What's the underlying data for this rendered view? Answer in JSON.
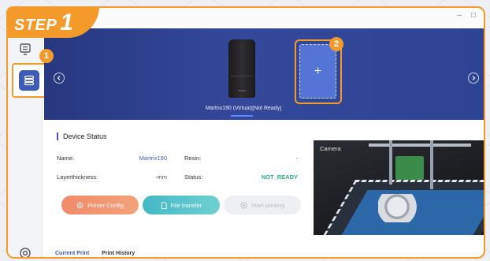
{
  "step_tag": {
    "word": "STEP",
    "number": "1"
  },
  "callouts": {
    "sidebar": "1",
    "add_printer": "2"
  },
  "window_controls": {
    "minimize": "–",
    "maximize": "□",
    "close": "×"
  },
  "sidebar": {
    "items": [
      {
        "icon": "monitor-icon"
      },
      {
        "icon": "devices-icon",
        "active": true
      },
      {
        "icon": "settings-icon"
      }
    ]
  },
  "banner": {
    "printer_label": "Martrix190 (Virtual)[Not Ready]",
    "add_symbol": "+"
  },
  "device_status": {
    "title": "Device Status",
    "name_label": "Name:",
    "name_value": "Martrix190",
    "resin_label": "Resin:",
    "resin_value": "-",
    "layer_label": "Layerthickness:",
    "layer_value": "-mm",
    "status_label": "Status:",
    "status_value": "NOT_READY"
  },
  "actions": {
    "printer_config": "Printer Config",
    "file_transfer": "File transfer",
    "start_printing": "Start printing"
  },
  "camera": {
    "label": "Camera"
  },
  "tabs": {
    "current_print": "Current Print",
    "print_history": "Print History"
  },
  "colors": {
    "accent_orange": "#f39a2a",
    "brand_blue": "#3e5bb5",
    "banner_blue": "#2f4393",
    "status_green": "#2ab07a"
  }
}
